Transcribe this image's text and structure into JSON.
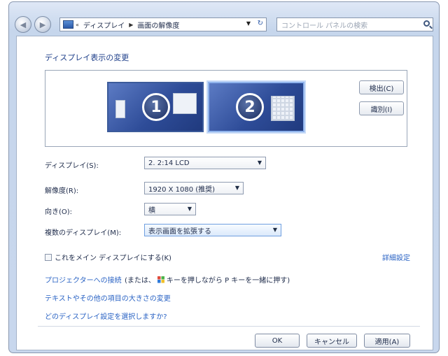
{
  "address_bar": {
    "breadcrumbs": [
      "ディスプレイ",
      "画面の解像度"
    ],
    "back_arrow": "«"
  },
  "search": {
    "placeholder": "コントロール パネルの検索"
  },
  "heading": "ディスプレイ表示の変更",
  "monitors": {
    "m1_number": "1",
    "m2_number": "2",
    "selected": "2"
  },
  "buttons": {
    "detect": "検出(C)",
    "identify": "識別(I)"
  },
  "settings": {
    "display": {
      "label": "ディスプレイ(S):",
      "value": "2. 2:14 LCD"
    },
    "resolution": {
      "label": "解像度(R):",
      "value": "1920 X 1080 (推奨)"
    },
    "orientation": {
      "label": "向き(O):",
      "value": "横"
    },
    "multiple_displays": {
      "label": "複数のディスプレイ(M):",
      "value": "表示画面を拡張する"
    }
  },
  "main_display_checkbox": {
    "label": "これをメイン ディスプレイにする(K)",
    "checked": false
  },
  "advanced_link": "詳細設定",
  "links": {
    "projector": "プロジェクターへの接続",
    "projector_tail_1": "(または、",
    "projector_tail_2": "キーを押しながら P キーを一緒に押す)",
    "text_size": "テキストやその他の項目の大きさの変更",
    "which_setting": "どのディスプレイ設定を選択しますか?"
  },
  "footer": {
    "ok": "OK",
    "cancel": "キャンセル",
    "apply": "適用(A)"
  },
  "colors": {
    "link": "#2a63c4",
    "heading": "#1e3f8a",
    "monitor_blue": "#2e4c98"
  }
}
